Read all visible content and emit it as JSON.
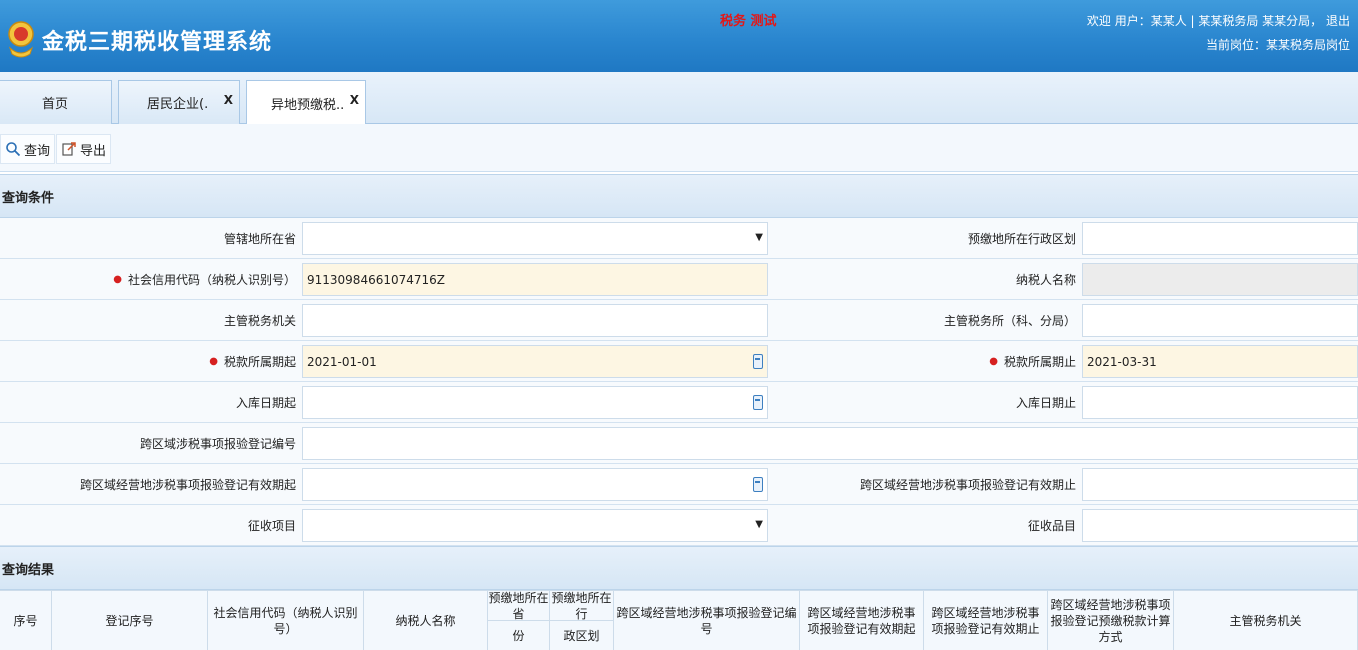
{
  "header": {
    "app_title": "金税三期税收管理系统",
    "env_badge": "税务 测试",
    "user_line1": "欢迎  用户：某某人 | 某某税务局 某某分局，    退出",
    "user_line2": "当前岗位：某某税务局岗位"
  },
  "tabs": [
    {
      "label": "首页",
      "closable": false
    },
    {
      "label": "居民企业(.",
      "closable": true
    },
    {
      "label": "异地预缴税..",
      "closable": true
    }
  ],
  "toolbar": {
    "query_label": "查询",
    "export_label": "导出"
  },
  "query_section": {
    "title": "查询条件"
  },
  "form": {
    "rows": [
      {
        "left_label": "管辖地所在省",
        "left_required": false,
        "left_value": "",
        "left_type": "select",
        "right_label": "预缴地所在行政区划",
        "right_required": false,
        "right_value": "",
        "right_type": "text"
      },
      {
        "left_label": "社会信用代码（纳税人识别号）",
        "left_required": true,
        "left_value": "91130984661074716Z",
        "left_type": "text-yellow",
        "right_label": "纳税人名称",
        "right_required": false,
        "right_value": "",
        "right_type": "text-gray"
      },
      {
        "left_label": "主管税务机关",
        "left_required": false,
        "left_value": "",
        "left_type": "text",
        "right_label": "主管税务所（科、分局）",
        "right_required": false,
        "right_value": "",
        "right_type": "text"
      },
      {
        "left_label": "税款所属期起",
        "left_required": true,
        "left_value": "2021-01-01",
        "left_type": "date-yellow",
        "right_label": "税款所属期止",
        "right_required": true,
        "right_value": "2021-03-31",
        "right_type": "text-yellow"
      },
      {
        "left_label": "入库日期起",
        "left_required": false,
        "left_value": "",
        "left_type": "date",
        "right_label": "入库日期止",
        "right_required": false,
        "right_value": "",
        "right_type": "text"
      },
      {
        "left_label": "跨区域涉税事项报验登记编号",
        "left_required": false,
        "left_value": "",
        "left_type": "text-wide"
      },
      {
        "left_label": "跨区域经营地涉税事项报验登记有效期起",
        "left_required": false,
        "left_value": "",
        "left_type": "date",
        "right_label": "跨区域经营地涉税事项报验登记有效期止",
        "right_required": false,
        "right_value": "",
        "right_type": "text"
      },
      {
        "left_label": "征收项目",
        "left_required": false,
        "left_value": "",
        "left_type": "select",
        "right_label": "征收品目",
        "right_required": false,
        "right_value": "",
        "right_type": "text"
      }
    ]
  },
  "result_section": {
    "title": "查询结果"
  },
  "table": {
    "columns": [
      "序号",
      "登记序号",
      "社会信用代码（纳税人识别号）",
      "纳税人名称",
      "跨区域经营地涉税事项报验登记编号",
      "跨区域经营地涉税事项报验登记有效期起",
      "跨区域经营地涉税事项报验登记有效期止",
      "预缴税款计算方式",
      "主管税务机关"
    ],
    "group_header": "预缴地所在省",
    "group_header_b": "预缴地所在行",
    "sub_a": "份",
    "sub_b": "政区划",
    "merged_labels": [
      "跨区域经营地涉税事项报验登记编号",
      "跨区域经营地涉税事项报验登记有效期起",
      "跨区域经营地涉税事项报验登记有效期止",
      "跨区域经营地涉税事项报验登记预缴税款计算方式",
      "主管税务机关"
    ]
  }
}
